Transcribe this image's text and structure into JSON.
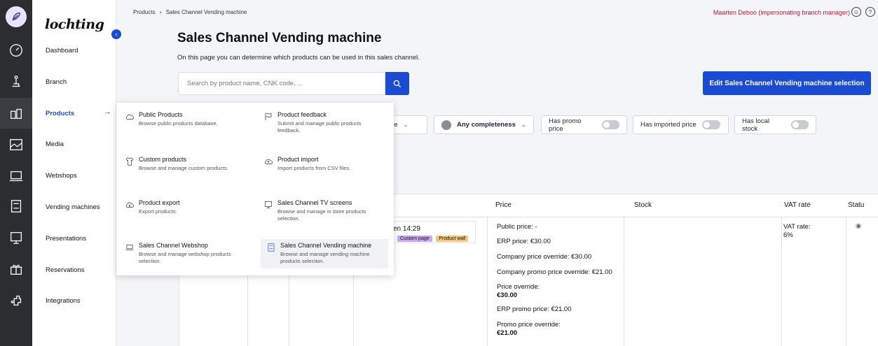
{
  "brand": "lochting",
  "breadcrumb": {
    "parent": "Products",
    "sep": "›",
    "current": "Sales Channel Vending machine"
  },
  "user": {
    "name": "Maarten Deboo (impersonating branch manager)"
  },
  "nav": {
    "items": [
      {
        "label": "Dashboard"
      },
      {
        "label": "Branch"
      },
      {
        "label": "Products"
      },
      {
        "label": "Media"
      },
      {
        "label": "Webshops"
      },
      {
        "label": "Vending machines"
      },
      {
        "label": "Presentations"
      },
      {
        "label": "Reservations"
      },
      {
        "label": "Integrations"
      }
    ],
    "arrow": "→"
  },
  "page": {
    "title": "Sales Channel Vending machine",
    "subtitle": "On this page you can determine which products can be used in this sales channel.",
    "search_placeholder": "Search by product name, CNK code, ...",
    "edit_button": "Edit Sales Channel Vending machine selection"
  },
  "filters": {
    "type_partial": "pe",
    "completeness": "Any completeness",
    "promo": "Has promo price",
    "imported": "Has imported price",
    "stock": "Has local stock"
  },
  "menu": [
    {
      "title": "Public Products",
      "desc": "Browse public products database.",
      "icon": "cloud-icon"
    },
    {
      "title": "Product feedback",
      "desc": "Submit and manage public products feedback.",
      "icon": "flag-icon"
    },
    {
      "title": "Custom products",
      "desc": "Browse and manage custom products.",
      "icon": "shirt-icon"
    },
    {
      "title": "Product import",
      "desc": "Import products from CSV files.",
      "icon": "cloud-upload-icon"
    },
    {
      "title": "Product export",
      "desc": "Export products.",
      "icon": "cloud-download-icon"
    },
    {
      "title": "Sales Channel TV screens",
      "desc": "Browse and manage in store products selection.",
      "icon": "tv-screen-icon"
    },
    {
      "title": "Sales Channel Webshop",
      "desc": "Browse and manage webshop products selection.",
      "icon": "laptop-icon"
    },
    {
      "title": "Sales Channel Vending machine",
      "desc": "Browse and manage vending machine products selection.",
      "icon": "vending-icon"
    }
  ],
  "table": {
    "headers": {
      "price": "Price",
      "stock": "Stock",
      "vat": "VAT rate",
      "status": "Statu"
    },
    "row": {
      "date_partial": "en 14:29",
      "tags": [
        "Custom page",
        "Product wall"
      ],
      "public_price": "Public price: -",
      "erp_price": "ERP price: €30.00",
      "company_override": "Company price override: €30.00",
      "company_promo_override": "Company promo price override: €21.00",
      "price_override_label": "Price override:",
      "price_override_value": "€30.00",
      "erp_promo": "ERP promo price: €21.00",
      "promo_override_label": "Promo price override:",
      "promo_override_value": "€21.00",
      "vat_label": "VAT rate:",
      "vat_value": "6%"
    }
  },
  "colors": {
    "accent": "#1b4bd1",
    "user": "#c0143c",
    "tag_custom": "#c9a6f0",
    "tag_wall": "#f3c77a"
  }
}
